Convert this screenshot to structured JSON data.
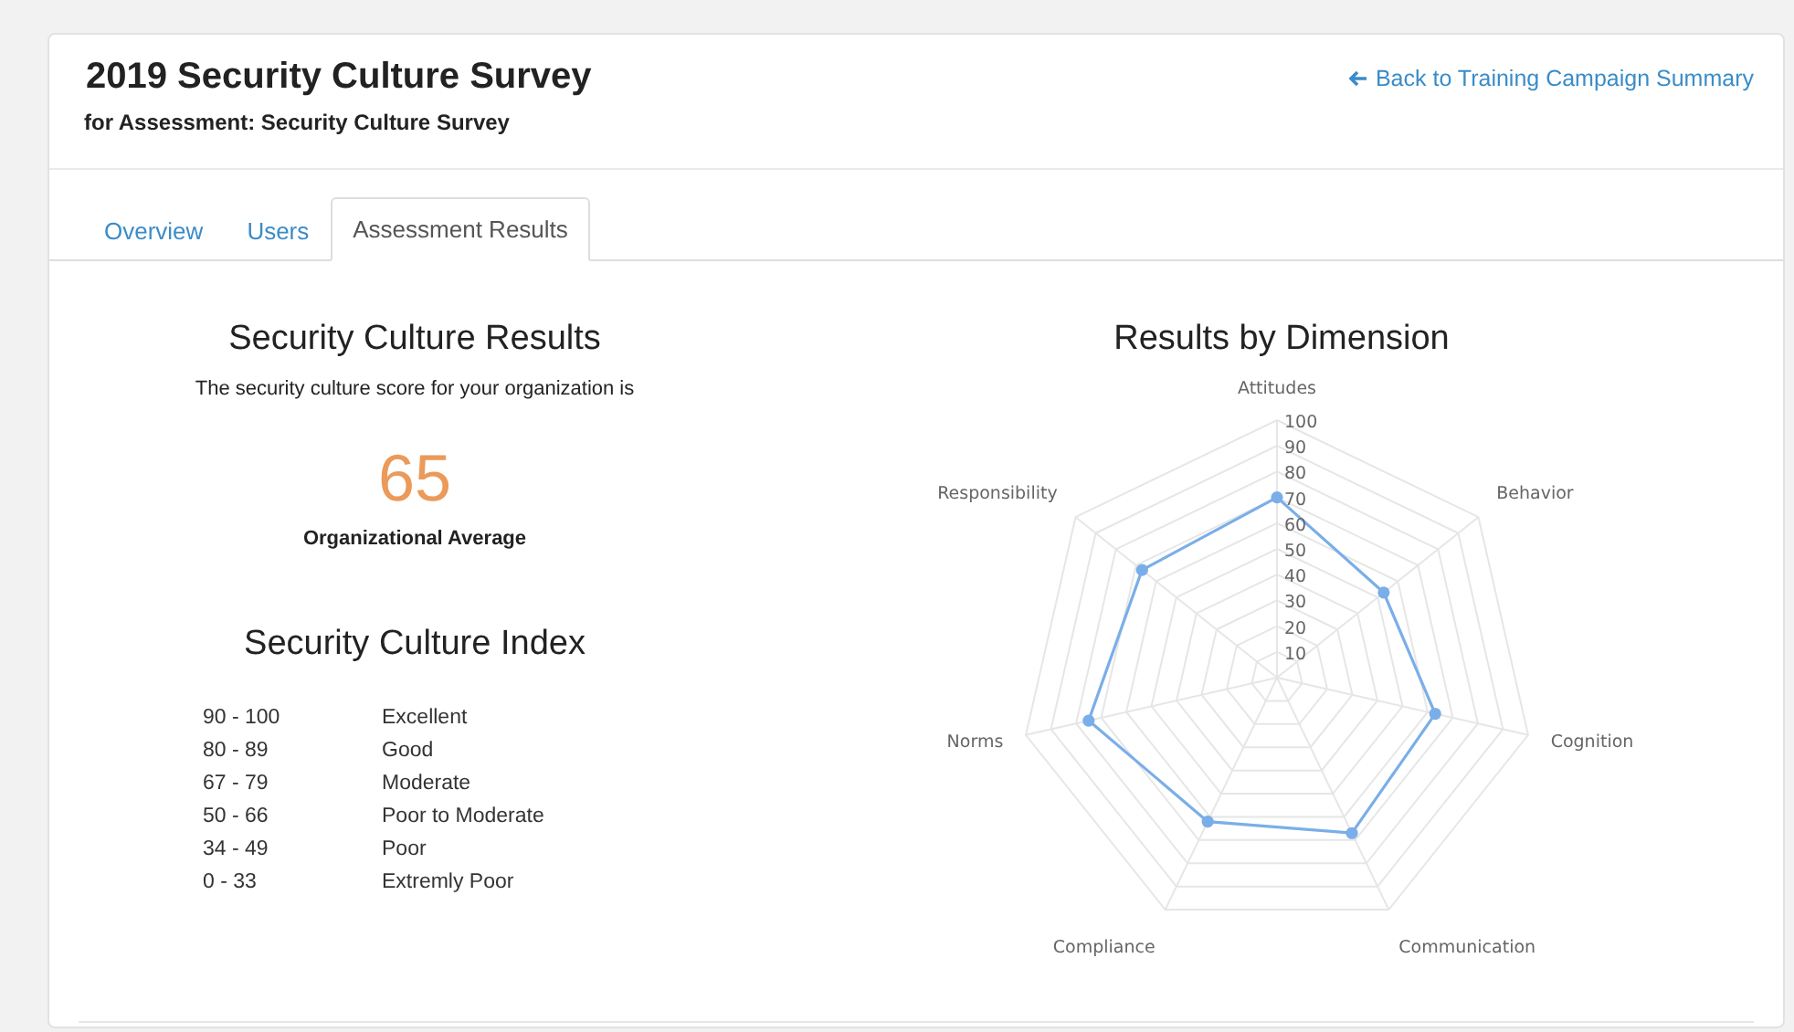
{
  "header": {
    "title": "2019 Security Culture Survey",
    "subtitle": "for Assessment: Security Culture Survey",
    "back_link": "Back to Training Campaign Summary"
  },
  "tabs": [
    {
      "label": "Overview",
      "selected": false
    },
    {
      "label": "Users",
      "selected": false
    },
    {
      "label": "Assessment Results",
      "selected": true
    }
  ],
  "results": {
    "title": "Security Culture Results",
    "description": "The security culture score for your organization is",
    "score": "65",
    "score_label": "Organizational Average"
  },
  "index": {
    "title": "Security Culture Index",
    "rows": [
      {
        "range": "90 - 100",
        "rating": "Excellent"
      },
      {
        "range": "80 - 89",
        "rating": "Good"
      },
      {
        "range": "67 - 79",
        "rating": "Moderate"
      },
      {
        "range": "50 - 66",
        "rating": "Poor to Moderate"
      },
      {
        "range": "34 - 49",
        "rating": "Poor"
      },
      {
        "range": "0 - 33",
        "rating": "Extremly Poor"
      }
    ]
  },
  "dimensions": {
    "title": "Results by Dimension",
    "chart_data": {
      "type": "radar",
      "categories": [
        "Attitudes",
        "Behavior",
        "Cognition",
        "Communication",
        "Compliance",
        "Norms",
        "Responsibility"
      ],
      "ylim": [
        0,
        100
      ],
      "yticks": [
        10,
        20,
        30,
        40,
        50,
        60,
        70,
        80,
        90,
        100
      ],
      "series": [
        {
          "color": "#7aaee8",
          "values": [
            70,
            53,
            63,
            67,
            62,
            75,
            67
          ]
        }
      ]
    }
  }
}
